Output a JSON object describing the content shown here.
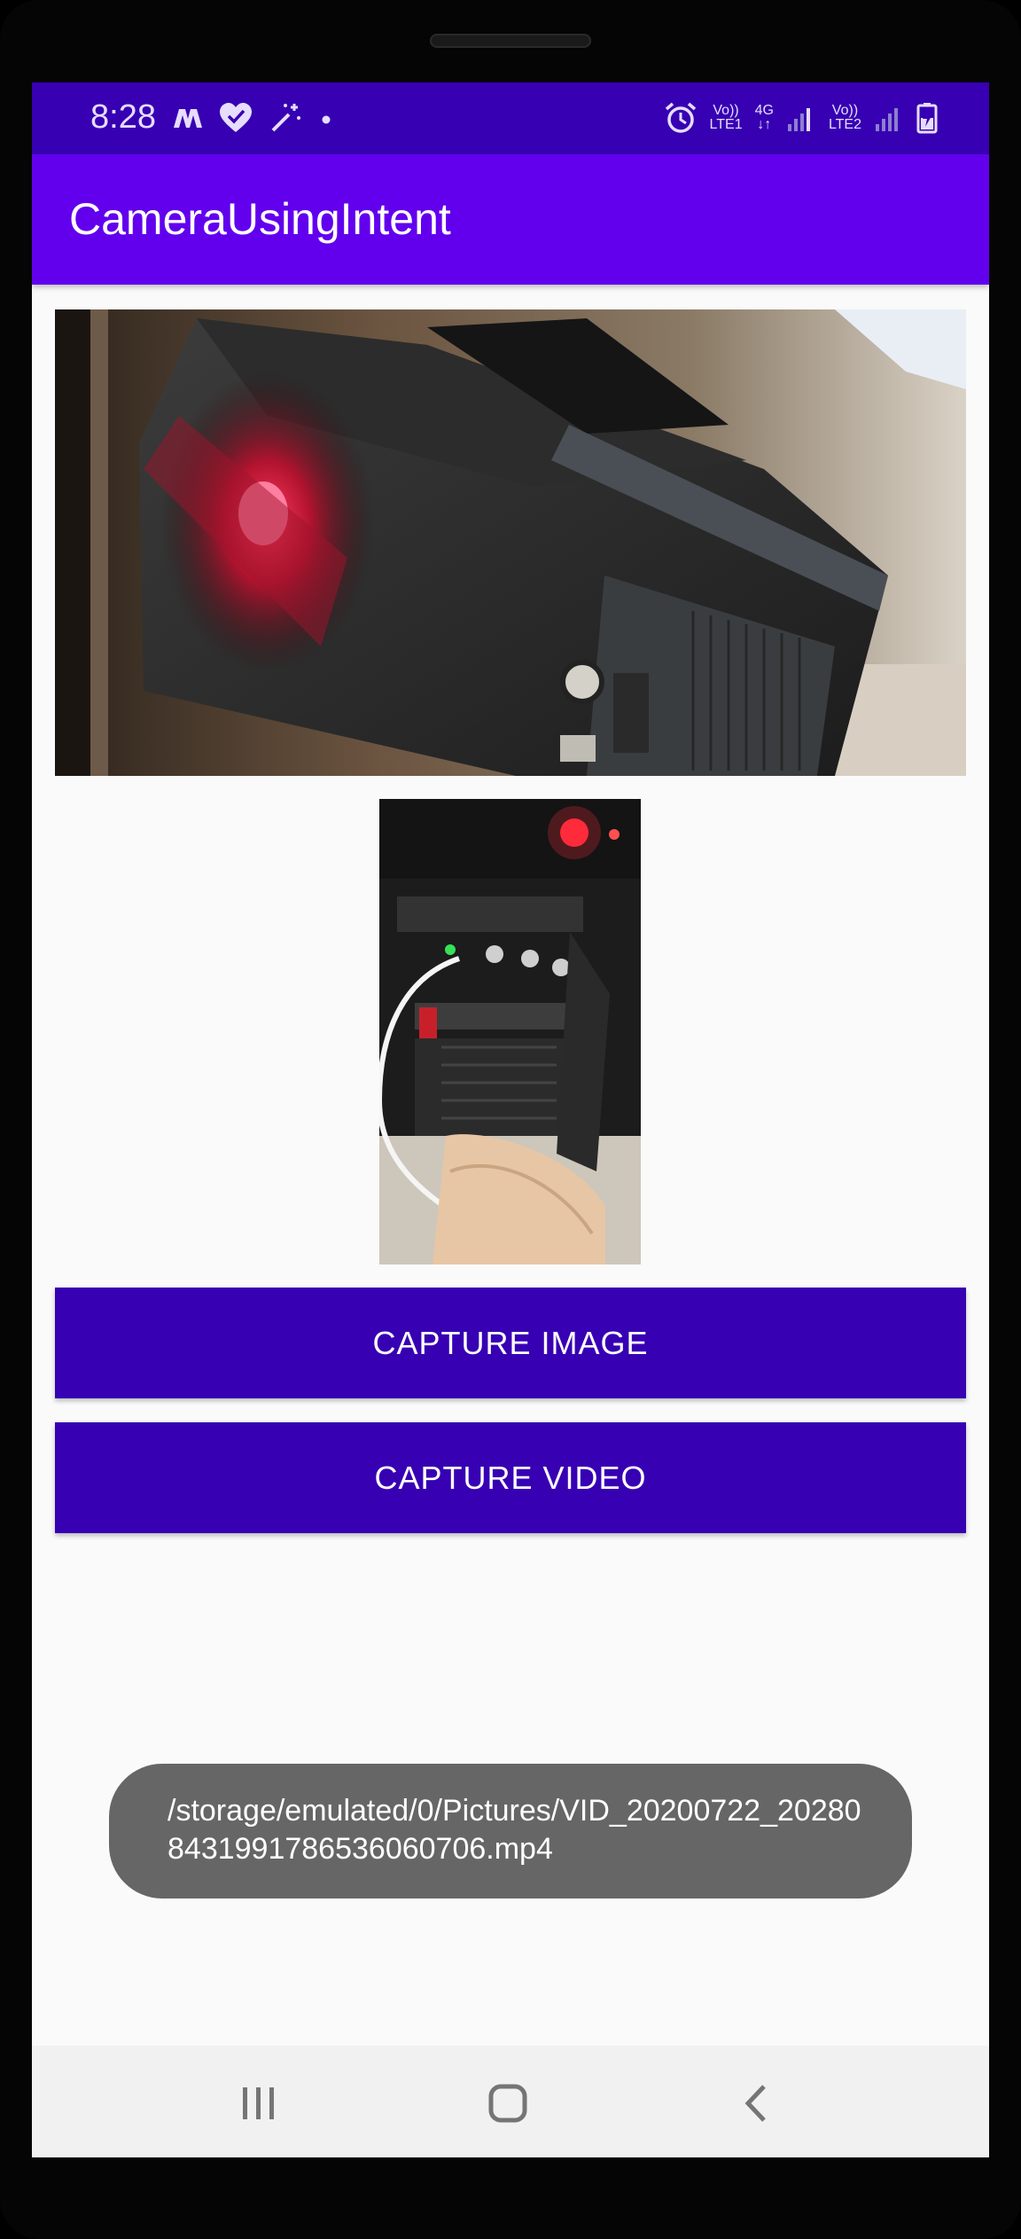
{
  "status_bar": {
    "time": "8:28",
    "sim1_top": "Vo))",
    "sim1_bottom": "LTE1",
    "net_top": "4G",
    "net_bottom": "↓↑",
    "sim2_top": "Vo))",
    "sim2_bottom": "LTE2",
    "icons_left": [
      "m-logo-icon",
      "heart-check-icon",
      "magic-wand-icon",
      "dot-icon"
    ],
    "icons_right": [
      "alarm-icon",
      "signal-icon",
      "signal-icon",
      "battery-charging-icon"
    ]
  },
  "app_bar": {
    "title": "CameraUsingIntent",
    "color": "#6200ee"
  },
  "buttons": {
    "capture_image": "CAPTURE IMAGE",
    "capture_video": "CAPTURE VIDEO",
    "color": "#3700b3"
  },
  "toast": {
    "text": "/storage/emulated/0/Pictures/VID_20200722_202808431991786536060706.mp4"
  },
  "nav_bar": {
    "icons": [
      "recent-apps-icon",
      "home-icon",
      "back-icon"
    ]
  }
}
